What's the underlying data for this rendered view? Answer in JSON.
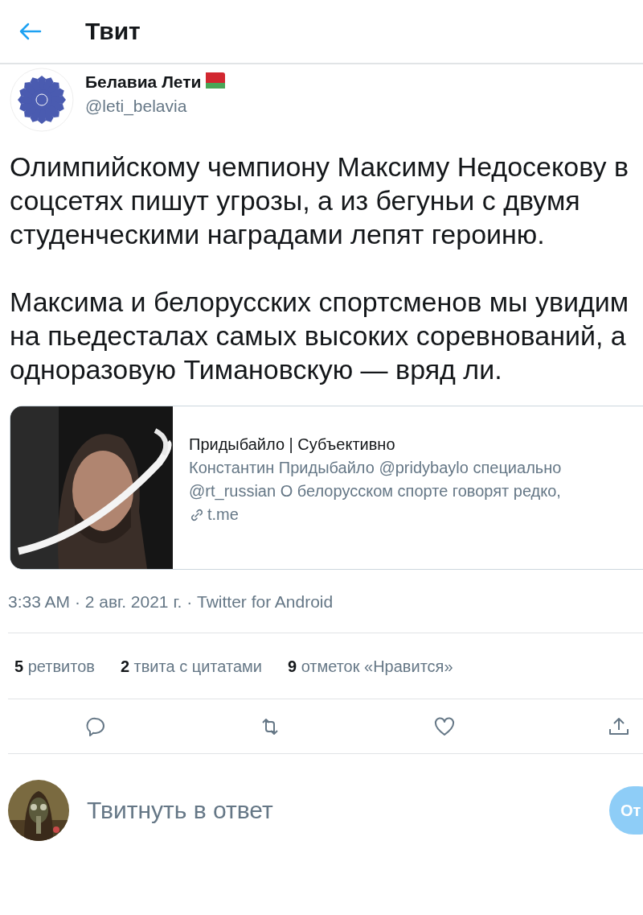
{
  "header": {
    "title": "Твит"
  },
  "author": {
    "name": "Белавиа Лети",
    "handle": "@leti_belavia"
  },
  "tweet": {
    "paragraphs": [
      "Олимпийскому чемпиону Максиму Недосекову в соцсетях пишут угрозы, а из бегуньи с двумя студенческими наградами лепят героиню.",
      "Максима и белорусских спортсменов мы увидим на пьедесталах самых высоких соревнований, а одноразовую Тимановскую — вряд ли."
    ]
  },
  "link_card": {
    "title": "Придыбайло | Субъективно",
    "description_lines": [
      "Константин Придыбайло @pridybaylo специально",
      "@rt_russian О белорусском спорте говорят редко,"
    ],
    "domain": "t.me"
  },
  "meta": "3:33 AM · 2 авг. 2021 г. · Twitter for Android",
  "stats": [
    "**5** ретвитов",
    "**2** твита с цитатами",
    "**9** отметок «Нравится»"
  ],
  "actions": [
    {
      "kind": "reply"
    },
    {
      "kind": "retweet"
    },
    {
      "kind": "like"
    },
    {
      "kind": "share"
    }
  ],
  "reply_bar": {
    "placeholder": "Твитнуть в ответ",
    "button": "От"
  }
}
